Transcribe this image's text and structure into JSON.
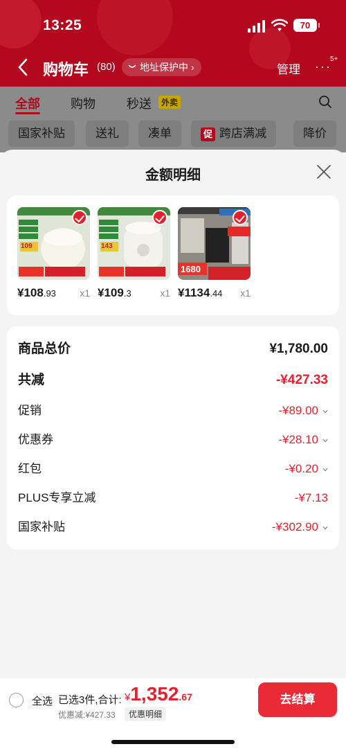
{
  "status_bar": {
    "time": "13:25",
    "battery": "70"
  },
  "nav": {
    "title": "购物车",
    "count": "(80)",
    "address_pill": "地址保护中",
    "manage": "管理",
    "more_badge": "5+"
  },
  "tabs": [
    {
      "label": "全部",
      "active": true
    },
    {
      "label": "购物",
      "active": false
    },
    {
      "label": "秒送",
      "active": false
    }
  ],
  "tab_tag": "外卖",
  "chips": [
    {
      "label": "国家补贴"
    },
    {
      "label": "送礼"
    },
    {
      "label": "凑单"
    },
    {
      "label": "跨店满减",
      "badge": "促"
    },
    {
      "label": "降价"
    }
  ],
  "sheet": {
    "title": "金额明细",
    "products": [
      {
        "price_int": "¥108",
        "price_dec": ".93",
        "qty": "x1",
        "image": "rice-cooker-white",
        "thumb_tag": "109"
      },
      {
        "price_int": "¥109",
        "price_dec": ".3",
        "qty": "x1",
        "image": "pressure-cooker-white",
        "thumb_tag": "143"
      },
      {
        "price_int": "¥1134",
        "price_dec": ".44",
        "qty": "x1",
        "image": "refrigerator-midea",
        "thumb_tag": "1680"
      }
    ],
    "rows": [
      {
        "label": "商品总价",
        "value": "¥1,780.00"
      },
      {
        "label": "共减",
        "value": "-¥427.33"
      },
      {
        "label": "促销",
        "value": "-¥89.00"
      },
      {
        "label": "优惠券",
        "value": "-¥28.10"
      },
      {
        "label": "红包",
        "value": "-¥0.20"
      },
      {
        "label": "PLUS专享立减",
        "value": "-¥7.13"
      },
      {
        "label": "国家补贴",
        "value": "-¥302.90"
      }
    ]
  },
  "bottom_bar": {
    "select_all": "全选",
    "selected_text": "已选3件,合计:",
    "currency": "¥",
    "total_int": "1,352",
    "total_dec": ".67",
    "discount_text": "优惠减:¥427.33",
    "detail_label": "优惠明细",
    "checkout": "去结算"
  },
  "colors": {
    "brand_red": "#e5202e",
    "header_red": "#b3081d",
    "checkout_red": "#ea2a37"
  }
}
